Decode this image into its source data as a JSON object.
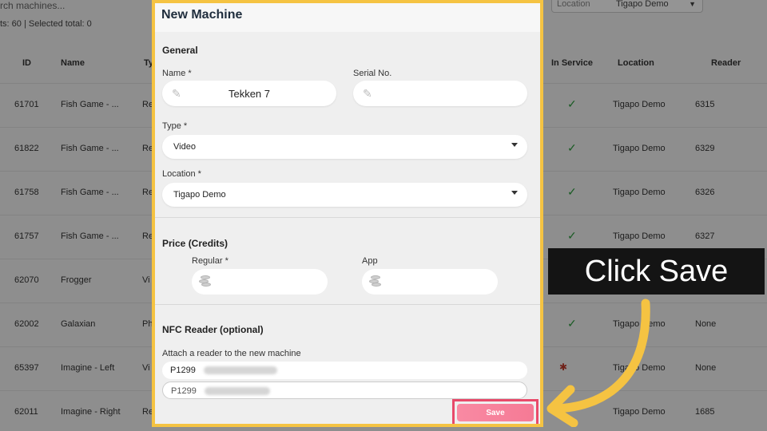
{
  "background": {
    "search_placeholder": "rch machines...",
    "counts_text": "ts: 60 | Selected total: 0",
    "location_filter": {
      "label": "Location",
      "value": "Tigapo Demo"
    },
    "columns": [
      "ID",
      "Name",
      "Ty",
      "In Service",
      "Location",
      "Reader"
    ],
    "rows": [
      {
        "id": "61701",
        "name": "Fish Game - ...",
        "type": "Re",
        "in_service": "✓",
        "location": "Tigapo Demo",
        "reader": "6315"
      },
      {
        "id": "61822",
        "name": "Fish Game - ...",
        "type": "Re",
        "in_service": "✓",
        "location": "Tigapo Demo",
        "reader": "6329"
      },
      {
        "id": "61758",
        "name": "Fish Game - ...",
        "type": "Re",
        "in_service": "✓",
        "location": "Tigapo Demo",
        "reader": "6326"
      },
      {
        "id": "61757",
        "name": "Fish Game - ...",
        "type": "Re",
        "in_service": "✓",
        "location": "Tigapo Demo",
        "reader": "6327"
      },
      {
        "id": "62070",
        "name": "Frogger",
        "type": "Vi",
        "in_service": "",
        "location": "",
        "reader": ""
      },
      {
        "id": "62002",
        "name": "Galaxian",
        "type": "Ph",
        "in_service": "✓",
        "location": "Tigapo Demo",
        "reader": "None"
      },
      {
        "id": "65397",
        "name": "Imagine - Left",
        "type": "Vi",
        "in_service": "",
        "location": "Tigapo Demo",
        "reader": "None"
      },
      {
        "id": "62011",
        "name": "Imagine - Right",
        "type": "Redemption T...",
        "in_service": "",
        "location": "Tigapo Demo",
        "reader": "1685"
      }
    ]
  },
  "modal": {
    "title": "New Machine",
    "general": {
      "heading": "General",
      "name_label": "Name *",
      "name_value": "Tekken 7",
      "serial_label": "Serial No.",
      "serial_value": "",
      "type_label": "Type *",
      "type_value": "Video",
      "location_label": "Location *",
      "location_value": "Tigapo Demo"
    },
    "price": {
      "heading": "Price (Credits)",
      "regular_label": "Regular *",
      "app_label": "App"
    },
    "nfc": {
      "heading": "NFC Reader (optional)",
      "hint": "Attach a reader to the new machine",
      "input_value": "P1299",
      "option_value": "P1299"
    },
    "save_label": "Save"
  },
  "callout": {
    "text": "Click Save"
  },
  "colors": {
    "highlight": "#f5c342",
    "save_border": "#e84a6a",
    "save_fill": "#f57a95",
    "arrow": "#f5c342"
  },
  "icons": [
    "pencil-icon",
    "coins-icon",
    "chevron-down-icon",
    "check-icon",
    "arrow-icon"
  ]
}
